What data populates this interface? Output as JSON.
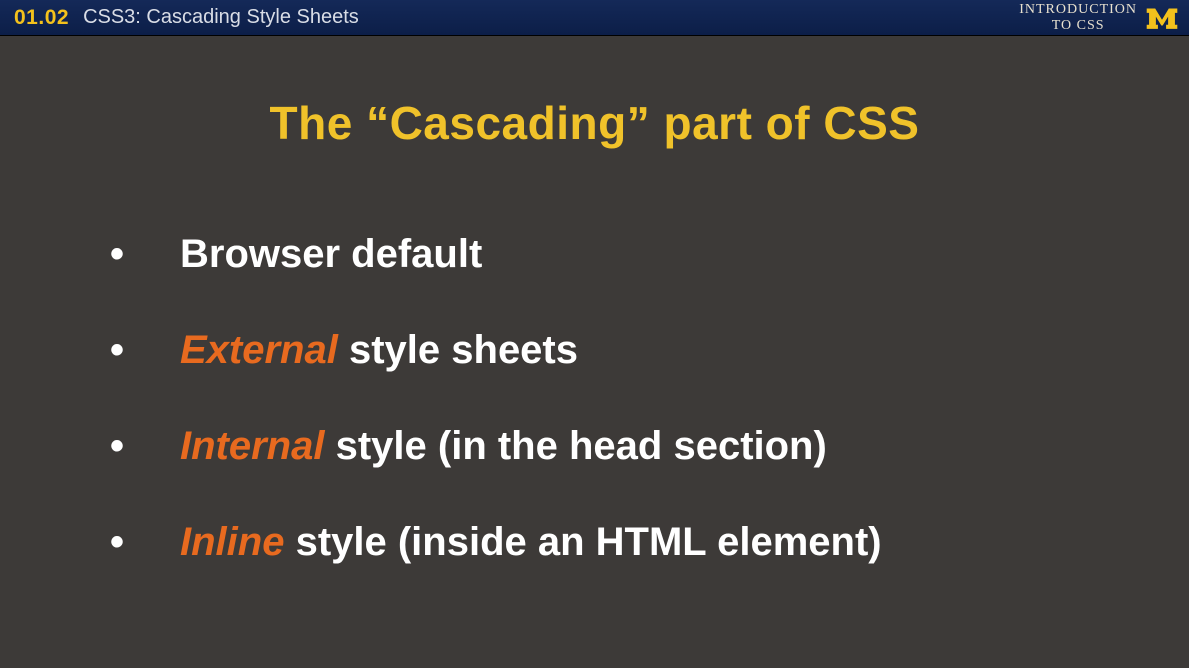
{
  "header": {
    "lesson_number": "01.02",
    "lesson_title": "CSS3: Cascading Style Sheets",
    "course_line1": "INTRODUCTION",
    "course_line2": "TO CSS"
  },
  "slide": {
    "title": "The “Cascading” part of CSS",
    "bullets": [
      {
        "pre": "",
        "em": "",
        "post": "Browser default"
      },
      {
        "pre": "",
        "em": "External",
        "post": " style sheets"
      },
      {
        "pre": "",
        "em": "Internal",
        "post": " style (in the head section)"
      },
      {
        "pre": "",
        "em": "Inline",
        "post": " style (inside an HTML element)"
      }
    ]
  }
}
